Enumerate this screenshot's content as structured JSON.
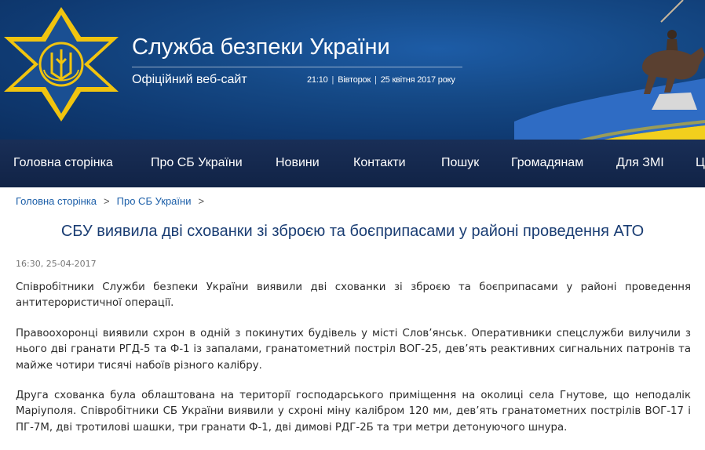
{
  "header": {
    "title": "Служба безпеки України",
    "subtitle": "Офіційний веб-сайт",
    "time": "21:10",
    "weekday": "Вівторок",
    "date": "25 квітня 2017 року",
    "colors": {
      "brand_blue": "#154986",
      "gold": "#f1c40f",
      "flag_blue": "#2f6cc4",
      "flag_yellow": "#f2cf1d"
    }
  },
  "nav": {
    "items": [
      "Головна сторінка",
      "Про СБ України",
      "Новини",
      "Контакти",
      "Пошук",
      "Громадянам",
      "Для ЗМІ",
      "Ц"
    ]
  },
  "breadcrumb": {
    "items": [
      "Головна сторінка",
      "Про СБ України"
    ]
  },
  "article": {
    "title": "СБУ виявила дві схованки зі зброєю та боєприпасами у районі проведення АТО",
    "timestamp": "16:30, 25-04-2017",
    "paragraphs": [
      "Співробітники Служби безпеки України виявили дві схованки зі зброєю та боєприпасами у районі проведення антитерористичної операції.",
      "Правоохоронці виявили схрон в одній з покинутих будівель у місті Слов’янськ. Оперативники спецслужби вилучили з нього дві гранати РГД-5 та Ф-1 із запалами, гранатометний постріл ВОГ-25, дев’ять реактивних сигнальних патронів та майже чотири тисячі набоїв різного калібру.",
      "Друга схованка була облаштована на території господарського приміщення на околиці села Гнутове, що неподалік Маріуполя. Співробітники СБ України виявили у схроні міну калібром 120 мм, дев’ять гранатометних пострілів ВОГ-17 і ПГ-7М, дві тротилові шашки, три гранати Ф-1, дві димові РДГ-2Б та три метри детонуючого шнура."
    ]
  }
}
